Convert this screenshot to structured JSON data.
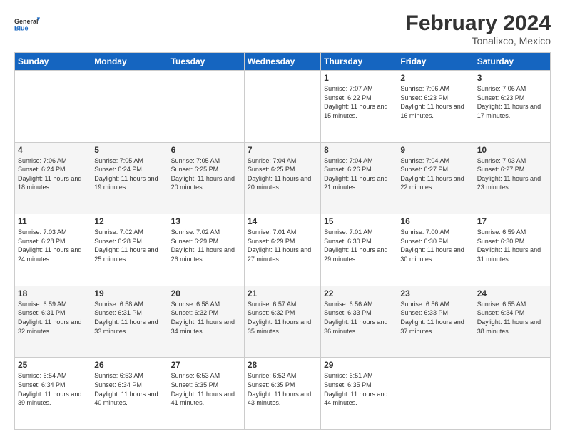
{
  "logo": {
    "line1": "General",
    "line2": "Blue"
  },
  "title": "February 2024",
  "subtitle": "Tonalixco, Mexico",
  "days_of_week": [
    "Sunday",
    "Monday",
    "Tuesday",
    "Wednesday",
    "Thursday",
    "Friday",
    "Saturday"
  ],
  "weeks": [
    [
      {
        "day": "",
        "info": ""
      },
      {
        "day": "",
        "info": ""
      },
      {
        "day": "",
        "info": ""
      },
      {
        "day": "",
        "info": ""
      },
      {
        "day": "1",
        "info": "Sunrise: 7:07 AM\nSunset: 6:22 PM\nDaylight: 11 hours and 15 minutes."
      },
      {
        "day": "2",
        "info": "Sunrise: 7:06 AM\nSunset: 6:23 PM\nDaylight: 11 hours and 16 minutes."
      },
      {
        "day": "3",
        "info": "Sunrise: 7:06 AM\nSunset: 6:23 PM\nDaylight: 11 hours and 17 minutes."
      }
    ],
    [
      {
        "day": "4",
        "info": "Sunrise: 7:06 AM\nSunset: 6:24 PM\nDaylight: 11 hours and 18 minutes."
      },
      {
        "day": "5",
        "info": "Sunrise: 7:05 AM\nSunset: 6:24 PM\nDaylight: 11 hours and 19 minutes."
      },
      {
        "day": "6",
        "info": "Sunrise: 7:05 AM\nSunset: 6:25 PM\nDaylight: 11 hours and 20 minutes."
      },
      {
        "day": "7",
        "info": "Sunrise: 7:04 AM\nSunset: 6:25 PM\nDaylight: 11 hours and 20 minutes."
      },
      {
        "day": "8",
        "info": "Sunrise: 7:04 AM\nSunset: 6:26 PM\nDaylight: 11 hours and 21 minutes."
      },
      {
        "day": "9",
        "info": "Sunrise: 7:04 AM\nSunset: 6:27 PM\nDaylight: 11 hours and 22 minutes."
      },
      {
        "day": "10",
        "info": "Sunrise: 7:03 AM\nSunset: 6:27 PM\nDaylight: 11 hours and 23 minutes."
      }
    ],
    [
      {
        "day": "11",
        "info": "Sunrise: 7:03 AM\nSunset: 6:28 PM\nDaylight: 11 hours and 24 minutes."
      },
      {
        "day": "12",
        "info": "Sunrise: 7:02 AM\nSunset: 6:28 PM\nDaylight: 11 hours and 25 minutes."
      },
      {
        "day": "13",
        "info": "Sunrise: 7:02 AM\nSunset: 6:29 PM\nDaylight: 11 hours and 26 minutes."
      },
      {
        "day": "14",
        "info": "Sunrise: 7:01 AM\nSunset: 6:29 PM\nDaylight: 11 hours and 27 minutes."
      },
      {
        "day": "15",
        "info": "Sunrise: 7:01 AM\nSunset: 6:30 PM\nDaylight: 11 hours and 29 minutes."
      },
      {
        "day": "16",
        "info": "Sunrise: 7:00 AM\nSunset: 6:30 PM\nDaylight: 11 hours and 30 minutes."
      },
      {
        "day": "17",
        "info": "Sunrise: 6:59 AM\nSunset: 6:30 PM\nDaylight: 11 hours and 31 minutes."
      }
    ],
    [
      {
        "day": "18",
        "info": "Sunrise: 6:59 AM\nSunset: 6:31 PM\nDaylight: 11 hours and 32 minutes."
      },
      {
        "day": "19",
        "info": "Sunrise: 6:58 AM\nSunset: 6:31 PM\nDaylight: 11 hours and 33 minutes."
      },
      {
        "day": "20",
        "info": "Sunrise: 6:58 AM\nSunset: 6:32 PM\nDaylight: 11 hours and 34 minutes."
      },
      {
        "day": "21",
        "info": "Sunrise: 6:57 AM\nSunset: 6:32 PM\nDaylight: 11 hours and 35 minutes."
      },
      {
        "day": "22",
        "info": "Sunrise: 6:56 AM\nSunset: 6:33 PM\nDaylight: 11 hours and 36 minutes."
      },
      {
        "day": "23",
        "info": "Sunrise: 6:56 AM\nSunset: 6:33 PM\nDaylight: 11 hours and 37 minutes."
      },
      {
        "day": "24",
        "info": "Sunrise: 6:55 AM\nSunset: 6:34 PM\nDaylight: 11 hours and 38 minutes."
      }
    ],
    [
      {
        "day": "25",
        "info": "Sunrise: 6:54 AM\nSunset: 6:34 PM\nDaylight: 11 hours and 39 minutes."
      },
      {
        "day": "26",
        "info": "Sunrise: 6:53 AM\nSunset: 6:34 PM\nDaylight: 11 hours and 40 minutes."
      },
      {
        "day": "27",
        "info": "Sunrise: 6:53 AM\nSunset: 6:35 PM\nDaylight: 11 hours and 41 minutes."
      },
      {
        "day": "28",
        "info": "Sunrise: 6:52 AM\nSunset: 6:35 PM\nDaylight: 11 hours and 43 minutes."
      },
      {
        "day": "29",
        "info": "Sunrise: 6:51 AM\nSunset: 6:35 PM\nDaylight: 11 hours and 44 minutes."
      },
      {
        "day": "",
        "info": ""
      },
      {
        "day": "",
        "info": ""
      }
    ]
  ]
}
